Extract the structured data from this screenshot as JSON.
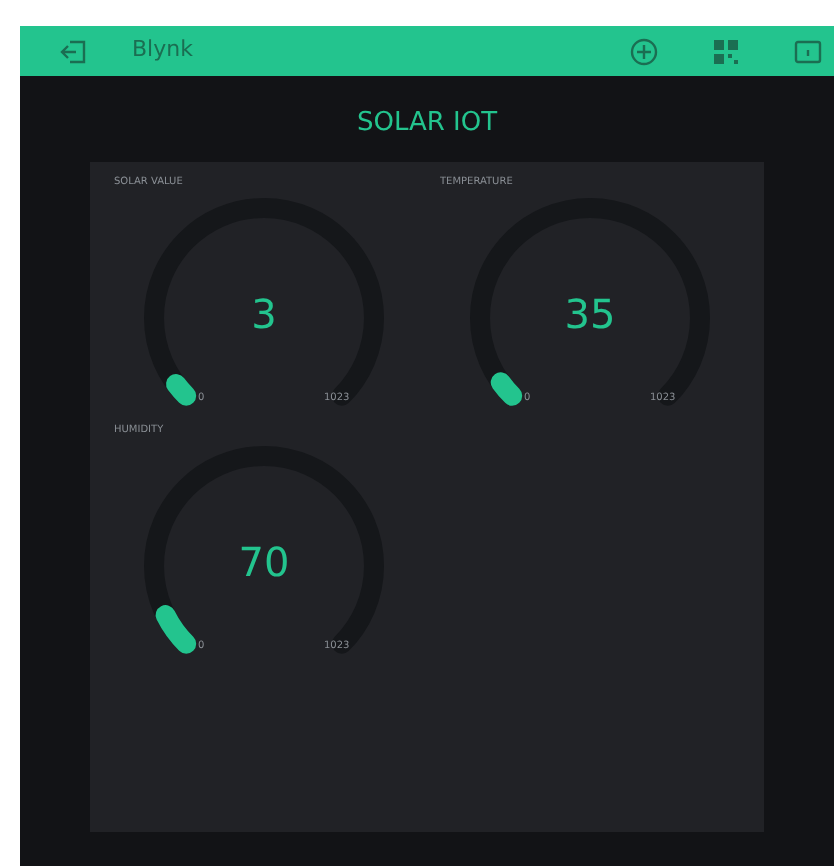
{
  "app_bar": {
    "title": "Blynk"
  },
  "project": {
    "title": "SOLAR IOT"
  },
  "gauges": [
    {
      "label": "SOLAR VALUE",
      "value": "3",
      "min": "0",
      "max": "1023"
    },
    {
      "label": "TEMPERATURE",
      "value": "35",
      "min": "0",
      "max": "1023"
    },
    {
      "label": "HUMIDITY",
      "value": "70",
      "min": "0",
      "max": "1023"
    }
  ]
}
